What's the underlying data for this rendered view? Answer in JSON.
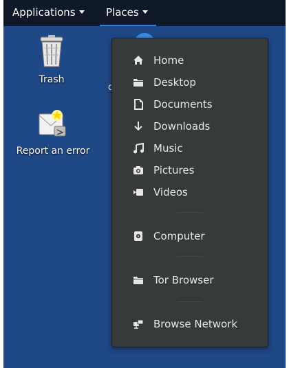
{
  "topbar": {
    "applications_label": "Applications",
    "places_label": "Places"
  },
  "desktop": {
    "trash_label": "Trash",
    "report_label": "Report an error",
    "partial_label": "d"
  },
  "places_menu": {
    "items": [
      {
        "label": "Home",
        "icon": "home-icon"
      },
      {
        "label": "Desktop",
        "icon": "folder-icon"
      },
      {
        "label": "Documents",
        "icon": "document-icon"
      },
      {
        "label": "Downloads",
        "icon": "download-icon"
      },
      {
        "label": "Music",
        "icon": "music-icon"
      },
      {
        "label": "Pictures",
        "icon": "camera-icon"
      },
      {
        "label": "Videos",
        "icon": "video-icon"
      },
      {
        "label": "Computer",
        "icon": "computer-icon"
      },
      {
        "label": "Tor Browser",
        "icon": "folder-icon"
      },
      {
        "label": "Browse Network",
        "icon": "network-icon"
      }
    ]
  },
  "colors": {
    "desktop_bg": "#1f4887",
    "topbar_bg": "#0e1826",
    "menu_bg": "#373a3a",
    "accent": "#3a7bd5"
  }
}
